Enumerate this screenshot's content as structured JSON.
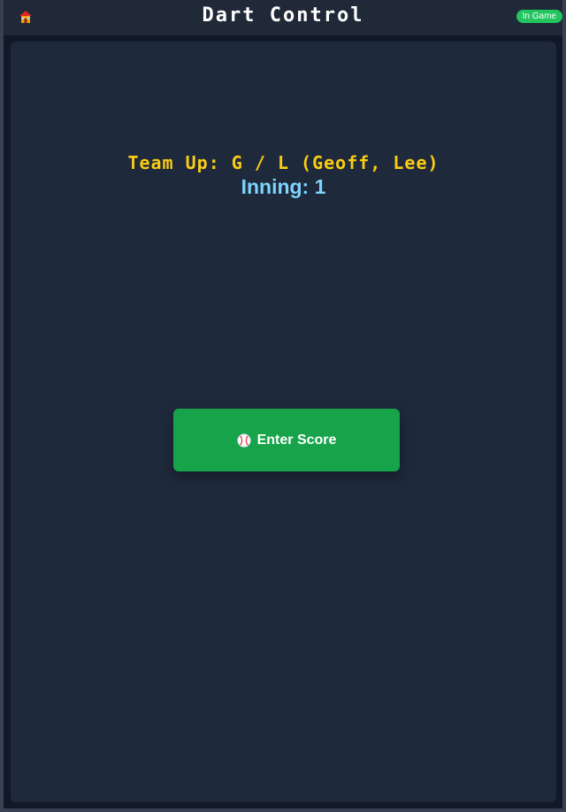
{
  "header": {
    "icon": "home-icon",
    "title": "Dart Control",
    "status": "In Game",
    "status_color": "#22c55e"
  },
  "game": {
    "team_up": "Team Up: G / L (Geoff, Lee)",
    "inning": "Inning: 1"
  },
  "actions": {
    "enter_score_icon": "baseball-icon",
    "enter_score_label": "Enter Score",
    "enter_score_color": "#16a34a"
  },
  "colors": {
    "background": "#111827",
    "panel": "#1e293b",
    "team_up_text": "#facc15",
    "inning_text": "#7dd3fc"
  }
}
